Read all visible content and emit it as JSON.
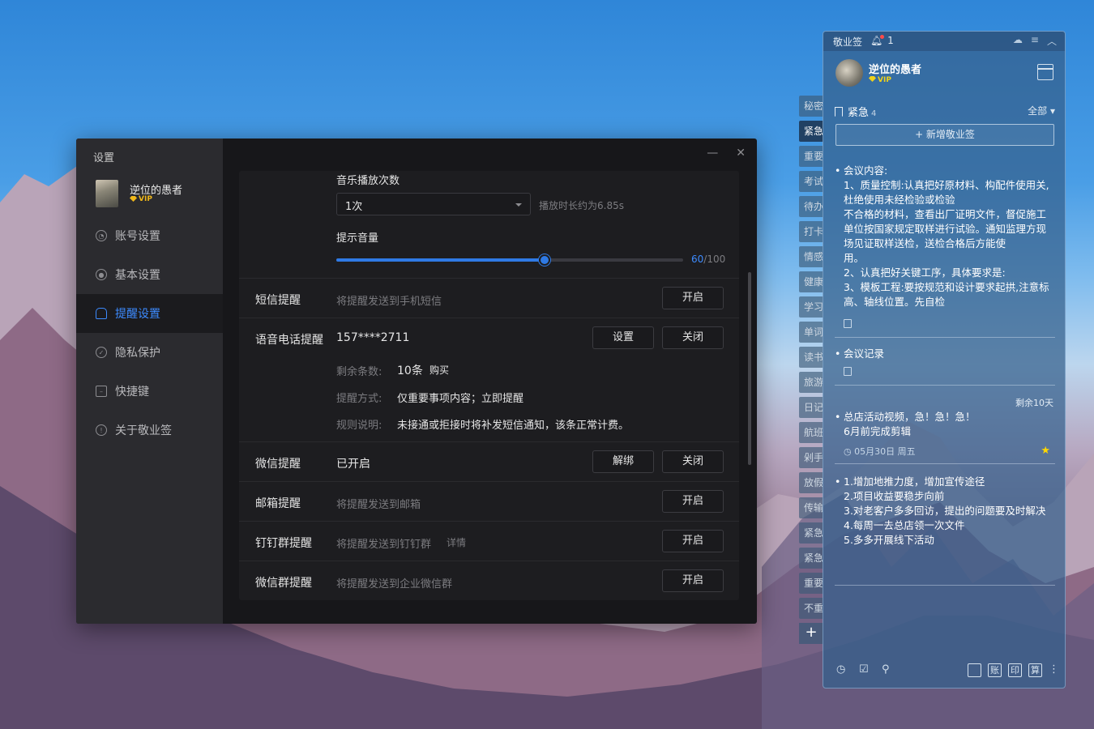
{
  "settings": {
    "title": "设置",
    "user": {
      "name": "逆位的愚者",
      "vip": "VIP"
    },
    "menu": [
      {
        "label": "账号设置",
        "icon": "account-icon"
      },
      {
        "label": "基本设置",
        "icon": "settings-icon"
      },
      {
        "label": "提醒设置",
        "icon": "bell-icon",
        "active": true
      },
      {
        "label": "隐私保护",
        "icon": "shield-icon"
      },
      {
        "label": "快捷键",
        "icon": "keyboard-icon"
      },
      {
        "label": "关于敬业签",
        "icon": "info-icon"
      }
    ],
    "window_controls": {
      "minimize": "—",
      "close": "✕"
    },
    "music": {
      "count_label": "音乐播放次数",
      "count_value": "1次",
      "duration_hint": "播放时长约为6.85s",
      "volume_label": "提示音量",
      "volume_value": "60",
      "volume_max": "/100",
      "volume_fraction": 0.6
    },
    "rows": {
      "sms": {
        "label": "短信提醒",
        "desc": "将提醒发送到手机短信",
        "btn": "开启"
      },
      "voice": {
        "label": "语音电话提醒",
        "phone": "157****2711",
        "btn_settings": "设置",
        "btn_toggle": "关闭",
        "remaining_key": "剩余条数:",
        "remaining_val": "10条",
        "buy": "购买",
        "mode_key": "提醒方式:",
        "mode_val": "仅重要事项内容；立即提醒",
        "rule_key": "规则说明:",
        "rule_val": "未接通或拒接时将补发短信通知，该条正常计费。"
      },
      "wechat": {
        "label": "微信提醒",
        "status": "已开启",
        "btn_unbind": "解绑",
        "btn_toggle": "关闭"
      },
      "email": {
        "label": "邮箱提醒",
        "desc": "将提醒发送到邮箱",
        "btn": "开启"
      },
      "dingtalk": {
        "label": "钉钉群提醒",
        "desc": "将提醒发送到钉钉群",
        "detail": "详情",
        "btn": "开启"
      },
      "wecom": {
        "label": "微信群提醒",
        "desc": "将提醒发送到企业微信群",
        "btn": "开启"
      }
    }
  },
  "notes": {
    "app_name": "敬业签",
    "unread": "1",
    "user": {
      "name": "逆位的愚者",
      "vip": "VIP"
    },
    "category": {
      "name": "紧急",
      "count": "4",
      "filter": "全部"
    },
    "new_note": "+ 新增敬业签",
    "tabs": [
      "秘密",
      "紧急",
      "重要",
      "考试",
      "待办",
      "打卡",
      "情感",
      "健康",
      "学习",
      "单词",
      "读书",
      "旅游",
      "日记",
      "航班",
      "剁手",
      "放假",
      "传输",
      "紧急",
      "紧急",
      "重要",
      "不重"
    ],
    "tab_add": "+",
    "items": [
      {
        "text": "会议内容:\n1、质量控制:认真把好原材料、构配件使用关,杜绝使用未经检验或检验\n不合格的材料，查看出厂证明文件，督促施工单位按国家规定取样进行试验。通知监理方现场见证取样送检，送检合格后方能使\n用。\n2、认真把好关键工序，具体要求是:\n3、模板工程:要按规范和设计要求起拱,注意标高、轴线位置。先自检"
      },
      {
        "text": "会议记录"
      },
      {
        "remaining": "剩余10天",
        "text": "总店活动视频，急！急！急！\n6月前完成剪辑",
        "date": "05月30日 周五"
      },
      {
        "text": "1.增加地推力度，增加宣传途径\n2.项目收益要稳步向前\n3.对老客户多多回访，提出的问题要及时解决\n4.每周一去总店领一次文件\n5.多多开展线下活动"
      }
    ],
    "bottom_boxes": [
      "",
      "账",
      "印",
      "算"
    ]
  },
  "colors": {
    "accent": "#3d8bff",
    "vip": "#f0b81a",
    "star": "#ffd800"
  }
}
